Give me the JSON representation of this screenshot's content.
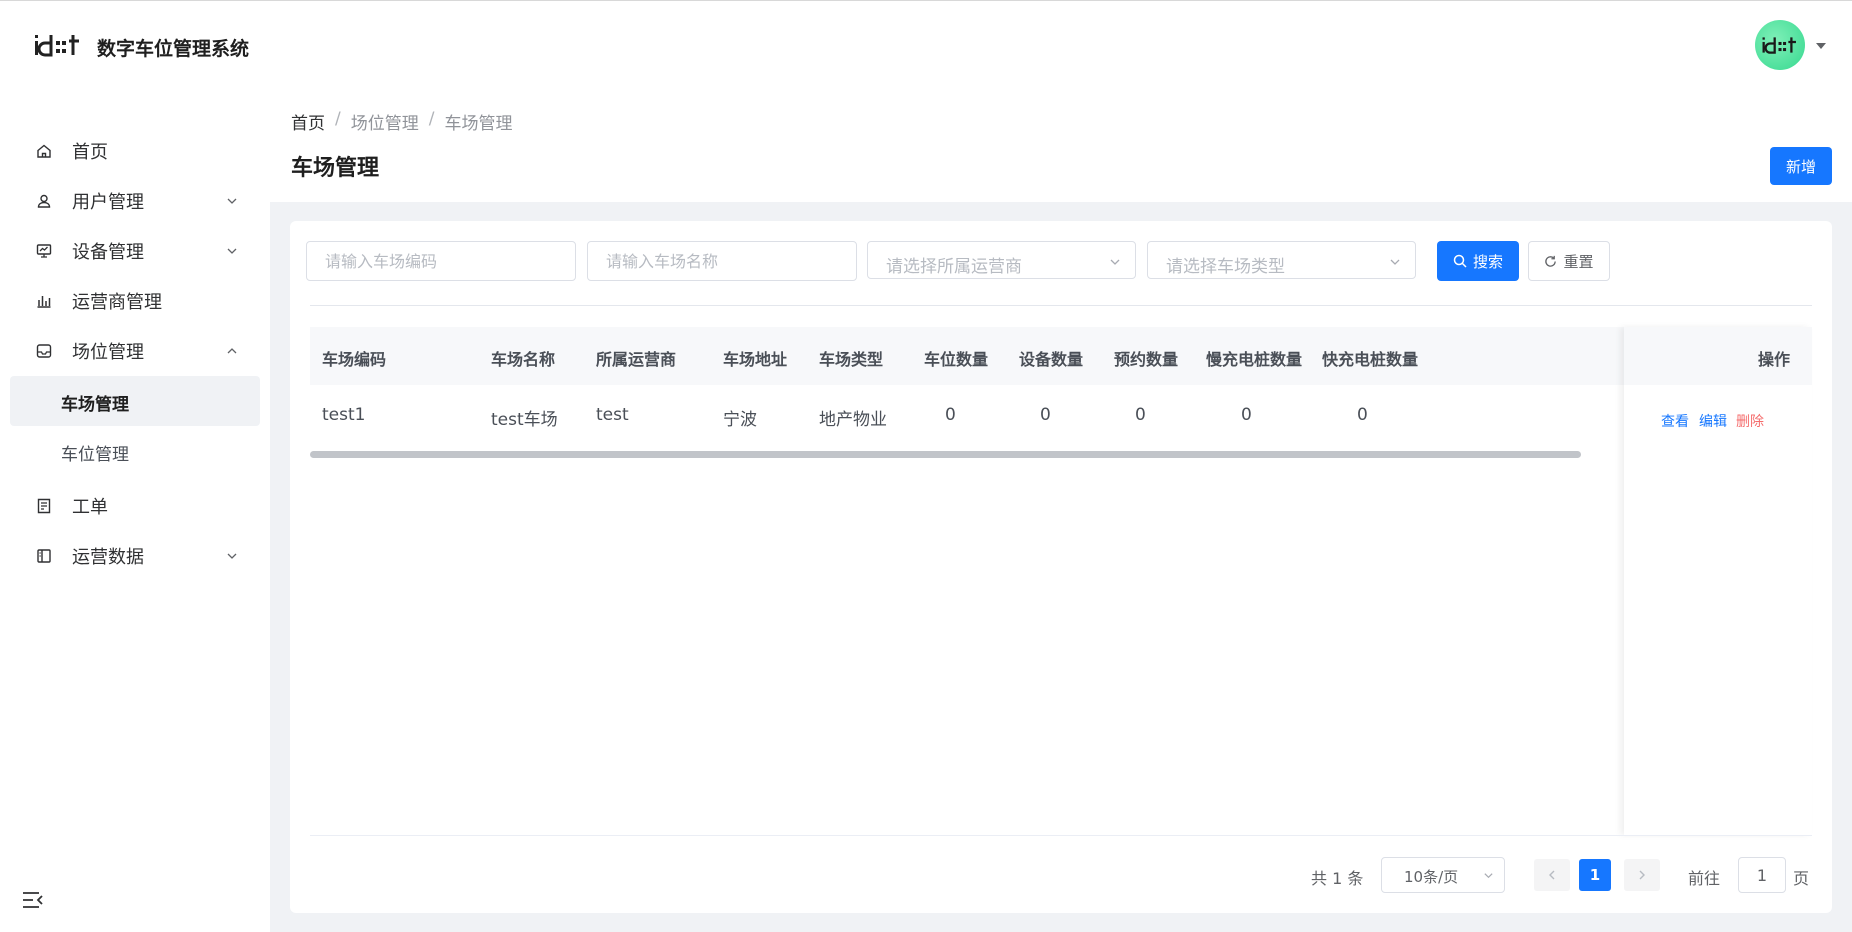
{
  "header": {
    "logo_text": "id∷t",
    "app_title": "数字车位管理系统",
    "avatar_text": "id∷t",
    "brand_color": "#1677ff"
  },
  "sidebar": {
    "items": [
      {
        "label": "首页",
        "icon": "home-icon"
      },
      {
        "label": "用户管理",
        "icon": "user-icon"
      },
      {
        "label": "设备管理",
        "icon": "monitor-icon"
      },
      {
        "label": "运营商管理",
        "icon": "bar-chart-icon"
      },
      {
        "label": "场位管理",
        "icon": "inbox-icon"
      },
      {
        "label": "工单",
        "icon": "document-icon"
      },
      {
        "label": "运营数据",
        "icon": "panel-icon"
      }
    ],
    "sub_items": [
      {
        "label": "车场管理",
        "active": true
      },
      {
        "label": "车位管理",
        "active": false
      }
    ]
  },
  "breadcrumb": [
    "首页",
    "场位管理",
    "车场管理"
  ],
  "breadcrumb_sep": "/",
  "page": {
    "title": "车场管理",
    "add_button": "新增"
  },
  "filters": {
    "code_placeholder": "请输入车场编码",
    "name_placeholder": "请输入车场名称",
    "operator_placeholder": "请选择所属运营商",
    "type_placeholder": "请选择车场类型",
    "search_button": "搜索",
    "reset_button": "重置"
  },
  "table": {
    "columns": [
      "车场编码",
      "车场名称",
      "所属运营商",
      "车场地址",
      "车场类型",
      "车位数量",
      "设备数量",
      "预约数量",
      "慢充电桩数量",
      "快充电桩数量",
      "操作"
    ],
    "rows": [
      {
        "code": "test1",
        "name": "test车场",
        "operator": "test",
        "address": "宁波",
        "type": "地产物业",
        "spaces": "0",
        "devices": "0",
        "reservations": "0",
        "slow_chargers": "0",
        "fast_chargers": "0"
      }
    ],
    "actions": {
      "view": "查看",
      "edit": "编辑",
      "delete": "删除"
    }
  },
  "pagination": {
    "total": "共 1 条",
    "page_size": "10条/页",
    "current_page": "1",
    "goto_label": "前往",
    "goto_value": "1",
    "page_suffix": "页"
  }
}
